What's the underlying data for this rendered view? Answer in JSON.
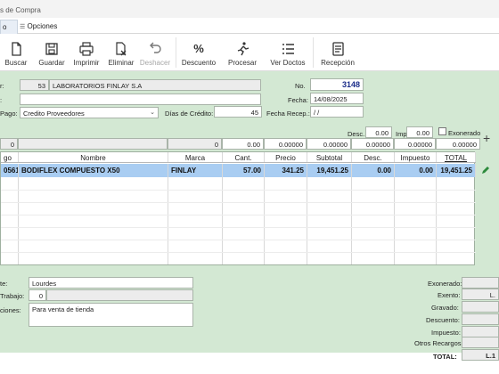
{
  "window": {
    "title": "s de Compra"
  },
  "menu": {
    "active_tab": "o",
    "options_label": "Opciones"
  },
  "toolbar": {
    "buscar": "Buscar",
    "guardar": "Guardar",
    "imprimir": "Imprimir",
    "eliminar": "Eliminar",
    "deshacer": "Deshacer",
    "descuento": "Descuento",
    "procesar": "Procesar",
    "ver_doctos": "Ver Doctos",
    "recepcion": "Recepción"
  },
  "header": {
    "proveedor_label": "r:",
    "proveedor_code": "53",
    "proveedor_name": "LABORATORIOS FINLAY S.A",
    "second_label": ":",
    "forma_pago_label": "Pago:",
    "forma_pago": "Credito Proveedores",
    "dias_credito_label": "Días de Crédito:",
    "dias_credito": "45",
    "no_label": "No.",
    "no_value": "3148",
    "fecha_label": "Fecha:",
    "fecha_value": "14/08/2025",
    "fecha_recep_label": "Fecha Recep.:",
    "fecha_recep_value": " / /"
  },
  "discounts": {
    "desc_label": "Desc.",
    "desc_value": "0.00",
    "imp_label": "Imp.",
    "imp_value": "0.00",
    "exonerado_label": "Exonerado"
  },
  "entry_row": {
    "codigo": "0",
    "nombre": "",
    "marca": "0",
    "cant": "0.00",
    "precio": "0.00000",
    "subtotal": "0.00000",
    "desc": "0.00000",
    "impuesto": "0.00000",
    "total": "0.00000"
  },
  "grid": {
    "columns": [
      "go",
      "Nombre",
      "Marca",
      "Cant.",
      "Precio",
      "Subtotal",
      "Desc.",
      "Impuesto",
      "TOTAL"
    ],
    "rows": [
      {
        "codigo": "0561",
        "nombre": "BODIFLEX COMPUESTO X50",
        "marca": "FINLAY",
        "cant": "57.00",
        "precio": "341.25",
        "subtotal": "19,451.25",
        "desc": "0.00",
        "impuesto": "0.00",
        "total": "19,451.25"
      }
    ]
  },
  "footer": {
    "agente_label": "te:",
    "agente_value": "Lourdes",
    "trabajo_label": "Trabajo:",
    "trabajo_value": "0",
    "obs_label": "ciones:",
    "obs_value": "Para venta de tienda",
    "totals": {
      "exonerado": "Exonerado:",
      "exento": "Exento:",
      "exento_value": "L.",
      "gravado": "Gravado:",
      "descuento": "Descuento:",
      "impuesto": "Impuesto:",
      "otros": "Otros Recargos:",
      "total": "TOTAL:",
      "total_value": "L.1"
    }
  },
  "colors": {
    "panel": "#d3e8d3",
    "selection": "#a9cdf2",
    "no_value": "#1b2d8a"
  }
}
